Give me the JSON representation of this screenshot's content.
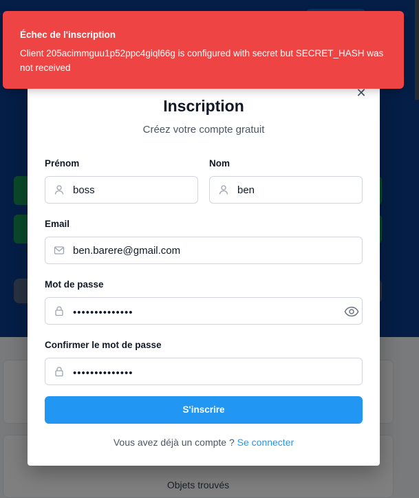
{
  "background": {
    "card_label": "Objets trouvés"
  },
  "modal": {
    "title": "Inscription",
    "subtitle": "Créez votre compte gratuit",
    "close_icon": "close-icon",
    "fields": {
      "first_name": {
        "label": "Prénom",
        "value": "boss",
        "icon": "user-icon"
      },
      "last_name": {
        "label": "Nom",
        "value": "ben",
        "icon": "user-icon"
      },
      "email": {
        "label": "Email",
        "value": "ben.barere@gmail.com",
        "icon": "mail-icon"
      },
      "password": {
        "label": "Mot de passe",
        "value": "••••••••••••••",
        "icon": "lock-icon",
        "toggle_icon": "eye-icon"
      },
      "confirm_password": {
        "label": "Confirmer le mot de passe",
        "value": "••••••••••••••",
        "icon": "lock-icon"
      }
    },
    "submit_label": "S'inscrire",
    "footer_text": "Vous avez déjà un compte ? ",
    "footer_link": "Se connecter"
  },
  "toast": {
    "title": "Échec de l'inscription",
    "message": "Client 205acimmguu1p52ppc4giql66g is configured with secret but SECRET_HASH was not received"
  },
  "colors": {
    "primary": "#2196f3",
    "error": "#ef4444",
    "hero": "#0b3d8f"
  }
}
